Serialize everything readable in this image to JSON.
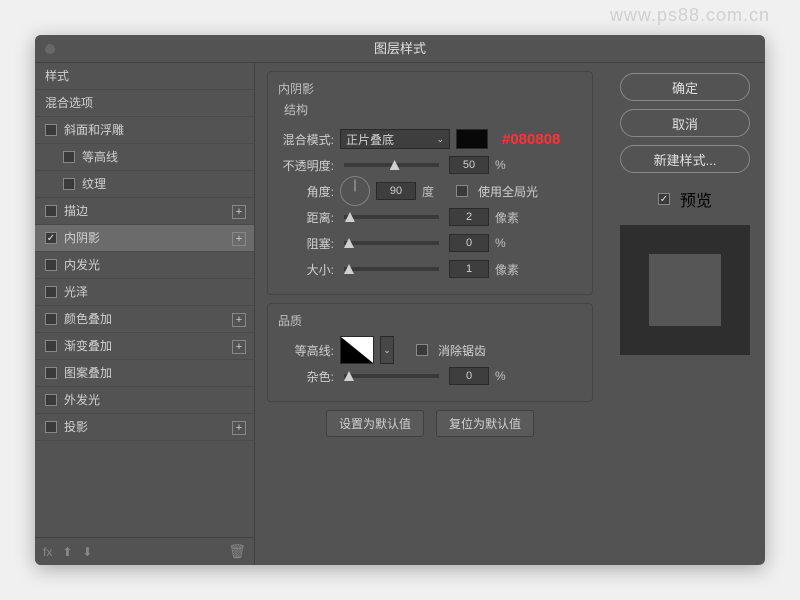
{
  "watermark": "www.ps88.com.cn",
  "title": "图层样式",
  "sidebar": {
    "styles_header": "样式",
    "blend_header": "混合选项",
    "items": [
      {
        "label": "斜面和浮雕",
        "checked": false,
        "plus": false,
        "indent": 0
      },
      {
        "label": "等高线",
        "checked": false,
        "plus": false,
        "indent": 1
      },
      {
        "label": "纹理",
        "checked": false,
        "plus": false,
        "indent": 1
      },
      {
        "label": "描边",
        "checked": false,
        "plus": true,
        "indent": 0
      },
      {
        "label": "内阴影",
        "checked": true,
        "plus": true,
        "indent": 0,
        "selected": true
      },
      {
        "label": "内发光",
        "checked": false,
        "plus": false,
        "indent": 0
      },
      {
        "label": "光泽",
        "checked": false,
        "plus": false,
        "indent": 0
      },
      {
        "label": "颜色叠加",
        "checked": false,
        "plus": true,
        "indent": 0
      },
      {
        "label": "渐变叠加",
        "checked": false,
        "plus": true,
        "indent": 0
      },
      {
        "label": "图案叠加",
        "checked": false,
        "plus": false,
        "indent": 0
      },
      {
        "label": "外发光",
        "checked": false,
        "plus": false,
        "indent": 0
      },
      {
        "label": "投影",
        "checked": false,
        "plus": true,
        "indent": 0
      }
    ]
  },
  "panel": {
    "heading": "内阴影",
    "structure_label": "结构",
    "blend_mode_label": "混合模式:",
    "blend_mode_value": "正片叠底",
    "color_hex": "#080808",
    "opacity_label": "不透明度:",
    "opacity_value": "50",
    "opacity_unit": "%",
    "angle_label": "角度:",
    "angle_value": "90",
    "angle_unit": "度",
    "global_light_label": "使用全局光",
    "distance_label": "距离:",
    "distance_value": "2",
    "distance_unit": "像素",
    "choke_label": "阻塞:",
    "choke_value": "0",
    "choke_unit": "%",
    "size_label": "大小:",
    "size_value": "1",
    "size_unit": "像素",
    "quality_label": "品质",
    "contour_label": "等高线:",
    "antialias_label": "消除锯齿",
    "noise_label": "杂色:",
    "noise_value": "0",
    "noise_unit": "%",
    "make_default": "设置为默认值",
    "reset_default": "复位为默认值"
  },
  "right": {
    "ok": "确定",
    "cancel": "取消",
    "new_style": "新建样式...",
    "preview": "预览"
  },
  "footer": {
    "fx": "fx"
  }
}
